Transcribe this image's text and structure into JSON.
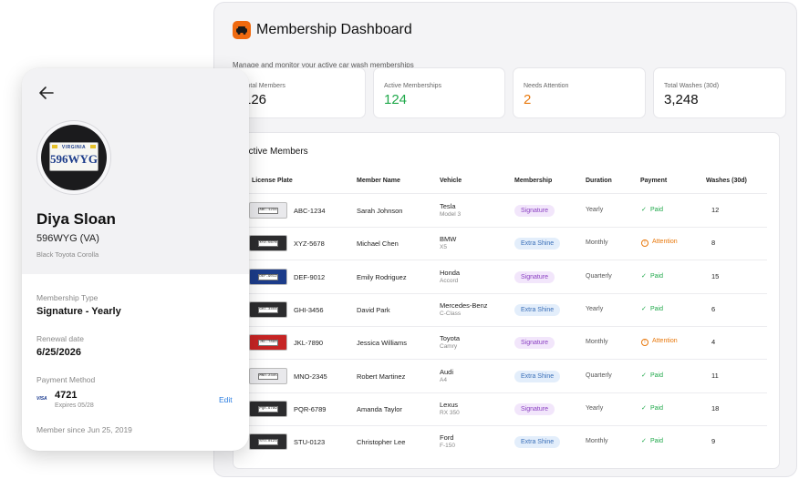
{
  "dashboard": {
    "title": "Membership Dashboard",
    "subtitle": "Manage and monitor your active car wash memberships",
    "brand_color": "#ef6a10",
    "stats": [
      {
        "label": "Total Members",
        "value": "126"
      },
      {
        "label": "Active Memberships",
        "value": "124"
      },
      {
        "label": "Needs Attention",
        "value": "2"
      },
      {
        "label": "Total Washes (30d)",
        "value": "3,248"
      }
    ],
    "members_panel": {
      "title": "Active Members",
      "columns": [
        "License Plate",
        "Member Name",
        "Vehicle",
        "Membership",
        "Duration",
        "Payment",
        "Washes (30d)"
      ],
      "rows": [
        {
          "plate": "ABC-1234",
          "name": "Sarah Johnson",
          "make": "Tesla",
          "model": "Model 3",
          "membership": "Signature",
          "duration": "Yearly",
          "payment": "Paid",
          "washes": "12"
        },
        {
          "plate": "XYZ-5678",
          "name": "Michael Chen",
          "make": "BMW",
          "model": "X5",
          "membership": "Extra Shine",
          "duration": "Monthly",
          "payment": "Attention",
          "washes": "8"
        },
        {
          "plate": "DEF-9012",
          "name": "Emily Rodriguez",
          "make": "Honda",
          "model": "Accord",
          "membership": "Signature",
          "duration": "Quarterly",
          "payment": "Paid",
          "washes": "15"
        },
        {
          "plate": "GHI-3456",
          "name": "David Park",
          "make": "Mercedes-Benz",
          "model": "C-Class",
          "membership": "Extra Shine",
          "duration": "Yearly",
          "payment": "Paid",
          "washes": "6"
        },
        {
          "plate": "JKL-7890",
          "name": "Jessica Williams",
          "make": "Toyota",
          "model": "Camry",
          "membership": "Signature",
          "duration": "Monthly",
          "payment": "Attention",
          "washes": "4"
        },
        {
          "plate": "MNO-2345",
          "name": "Robert Martinez",
          "make": "Audi",
          "model": "A4",
          "membership": "Extra Shine",
          "duration": "Quarterly",
          "payment": "Paid",
          "washes": "11"
        },
        {
          "plate": "PQR-6789",
          "name": "Amanda Taylor",
          "make": "Lexus",
          "model": "RX 350",
          "membership": "Signature",
          "duration": "Yearly",
          "payment": "Paid",
          "washes": "18"
        },
        {
          "plate": "STU-0123",
          "name": "Christopher Lee",
          "make": "Ford",
          "model": "F-150",
          "membership": "Extra Shine",
          "duration": "Monthly",
          "payment": "Paid",
          "washes": "9"
        }
      ]
    }
  },
  "member_card": {
    "back_icon": "arrow-left-icon",
    "license_state": "VIRGINIA",
    "license_number": "596WYG",
    "name": "Diya Sloan",
    "plate": "596WYG (VA)",
    "vehicle": "Black Toyota Corolla",
    "membership_type_label": "Membership Type",
    "membership_type": "Signature - Yearly",
    "renewal_label": "Renewal date",
    "renewal_date": "6/25/2026",
    "payment_label": "Payment Method",
    "card_brand": "VISA",
    "card_last4": "4721",
    "card_expiry": "Expires 05/28",
    "edit_label": "Edit",
    "member_since": "Member since Jun 25, 2019"
  },
  "colors": {
    "paid": "#1fa84a",
    "attention": "#e8780c",
    "signature_pill": "#8a3fc2",
    "extra_shine_pill": "#3a6fb8",
    "link": "#2b7de0"
  }
}
